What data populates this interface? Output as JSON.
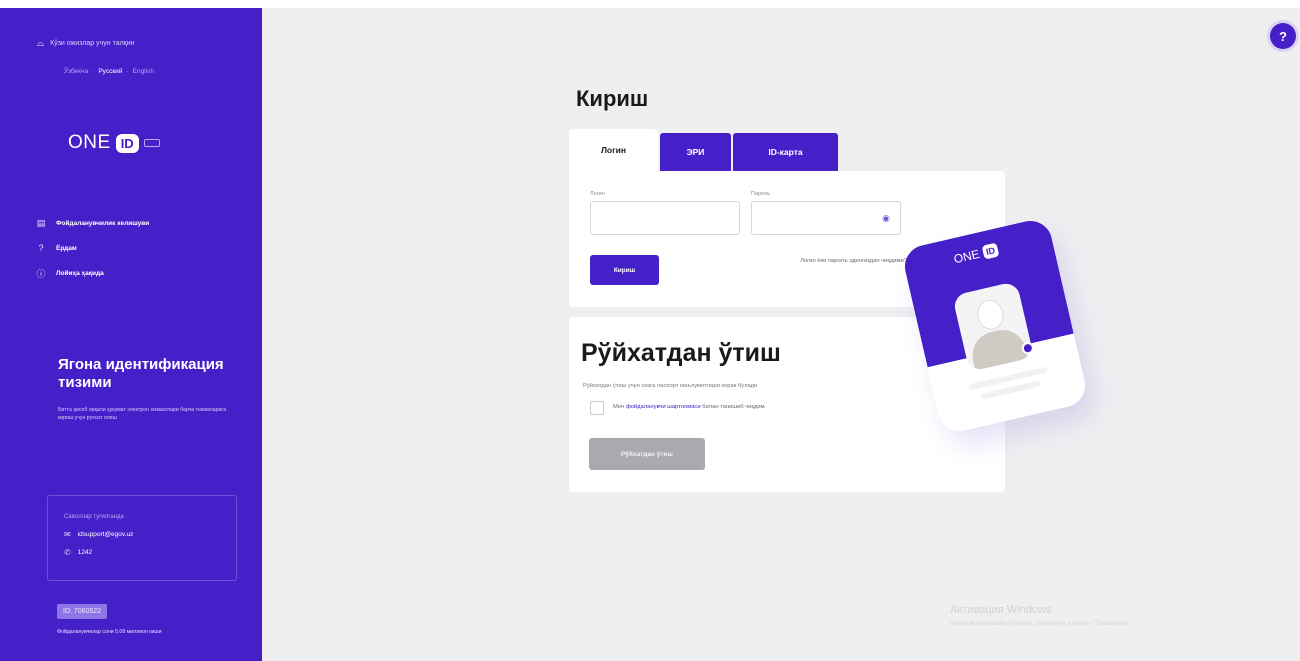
{
  "sidebar": {
    "accessibility_label": "Кўзи ожизлар учун талқин",
    "languages": [
      "Ўзбекча",
      "Русский",
      "English"
    ],
    "active_language": "Русский",
    "logo": {
      "text": "ONE",
      "badge": "ID"
    },
    "nav": [
      {
        "icon": "document-icon",
        "label": "Фойдаланувчилик келишуви"
      },
      {
        "icon": "question-icon",
        "label": "Ёрдам"
      },
      {
        "icon": "info-icon",
        "label": "Лойиҳа ҳақида"
      }
    ],
    "promo_title": "Ягона идентификация тизими",
    "promo_text": "Битта ҳисоб орқали ҳукумат электрон хизматлари барча тизимларига кириш учун рухсат олиш",
    "support": {
      "title": "Саволлар тугилганда",
      "email": "idsupport@egov.uz",
      "phone": "1242"
    },
    "version": "ID: 7060522",
    "users_text": "Фойдаланувчилар сони 5.08 миллион киши"
  },
  "help_label": "?",
  "login": {
    "heading": "Кириш",
    "tabs": [
      "Логин",
      "ЭРИ",
      "ID-карта"
    ],
    "active_tab": "Логин",
    "login_label": "Логин",
    "password_label": "Пароль",
    "login_value": "",
    "password_value": "",
    "submit": "Кириш",
    "forgot": "Логин ёки паролъ эдингиздан чиқдими?"
  },
  "register": {
    "title": "Рўйхатдан ўтиш",
    "note": "Рўйхатдан ўтиш учун сизга паспорт маълумотлари керак бўлади",
    "agree_prefix": "Мен ",
    "agree_link": "фойдаланувчи шартномаси",
    "agree_suffix": " билан танишиб чиқдим",
    "button": "Рўйхатдан ўтиш"
  },
  "illustration": {
    "logo_text": "ONE",
    "logo_badge": "ID"
  },
  "watermark": {
    "title": "Активация Windows",
    "subtitle": "Чтобы активировать Windows, перейдите в раздел \"Параметры\"."
  },
  "colors": {
    "brand": "#4520c9",
    "background": "#efeff1",
    "disabled_button": "#a9a9ae"
  }
}
